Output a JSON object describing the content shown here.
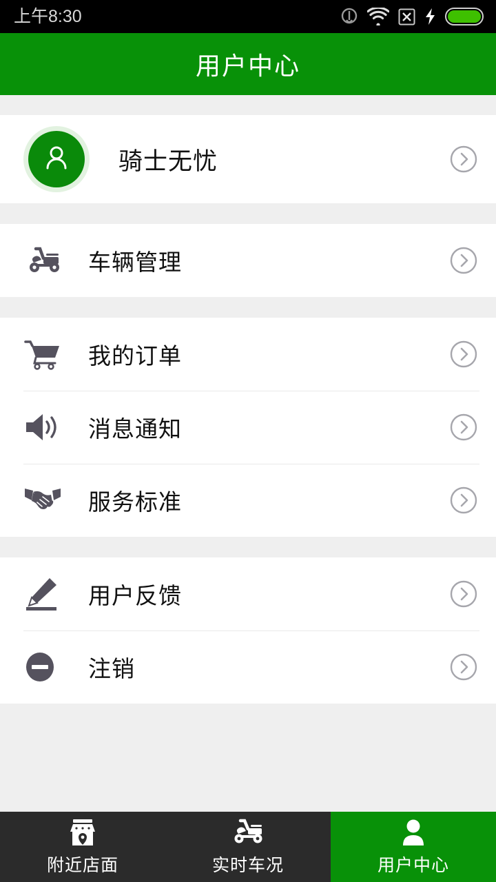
{
  "status_bar": {
    "time": "上午8:30",
    "icons": [
      {
        "name": "headset-icon"
      },
      {
        "name": "wifi-icon"
      },
      {
        "name": "no-sim-icon"
      },
      {
        "name": "charging-bolt-icon"
      },
      {
        "name": "battery-icon"
      }
    ]
  },
  "header": {
    "title": "用户中心"
  },
  "profile": {
    "name": "骑士无忧",
    "avatar_icon": "person-outline-icon",
    "chevron_icon": "chevron-right-circle-icon"
  },
  "groups": [
    {
      "items": [
        {
          "icon": "scooter-icon",
          "label": "车辆管理",
          "chevron": "chevron-right-circle-icon"
        }
      ]
    },
    {
      "items": [
        {
          "icon": "shopping-cart-icon",
          "label": "我的订单",
          "chevron": "chevron-right-circle-icon"
        },
        {
          "icon": "speaker-icon",
          "label": "消息通知",
          "chevron": "chevron-right-circle-icon"
        },
        {
          "icon": "handshake-icon",
          "label": "服务标准",
          "chevron": "chevron-right-circle-icon"
        }
      ]
    },
    {
      "items": [
        {
          "icon": "pencil-icon",
          "label": "用户反馈",
          "chevron": "chevron-right-circle-icon"
        },
        {
          "icon": "minus-circle-icon",
          "label": "注销",
          "chevron": "chevron-right-circle-icon"
        }
      ]
    }
  ],
  "bottom_nav": {
    "items": [
      {
        "icon": "storefront-icon",
        "label": "附近店面",
        "active": false
      },
      {
        "icon": "scooter-icon",
        "label": "实时车况",
        "active": false
      },
      {
        "icon": "person-filled-icon",
        "label": "用户中心",
        "active": true
      }
    ]
  },
  "colors": {
    "brand_green": "#089108",
    "avatar_green": "#0a8a0a",
    "avatar_halo": "#e2f2e0",
    "nav_dark": "#2b2b2b",
    "page_bg": "#efefef",
    "icon_gray": "#55525e",
    "chevron_gray": "#a6a6ac",
    "status_bar_bg": "#000000"
  }
}
